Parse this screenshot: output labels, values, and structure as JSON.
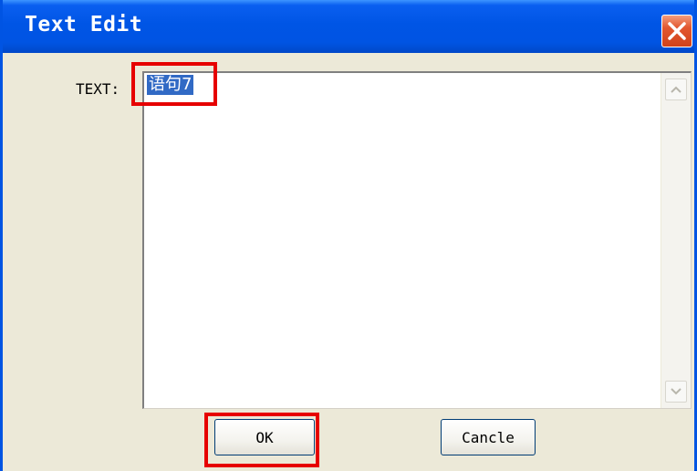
{
  "window": {
    "title": "Text Edit",
    "accent": "#0054e3",
    "close_color": "#e2572f"
  },
  "form": {
    "text_label": "TEXT:",
    "text_value": "语句7",
    "selection_color": "#316ac5"
  },
  "buttons": {
    "ok_label": "OK",
    "cancel_label": "Cancle"
  },
  "annotations": {
    "highlight_color": "#e60000"
  }
}
